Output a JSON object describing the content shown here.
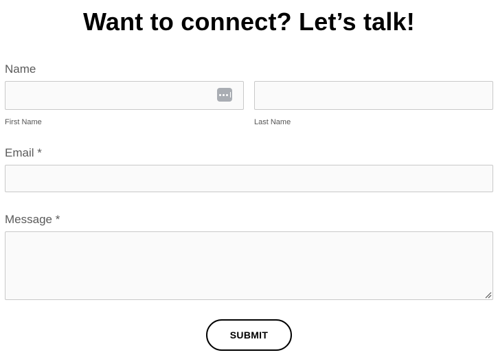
{
  "form": {
    "title": "Want to connect? Let’s talk!",
    "name": {
      "label": "Name",
      "first_name": {
        "value": "",
        "sublabel": "First Name"
      },
      "last_name": {
        "value": "",
        "sublabel": "Last Name"
      },
      "autofill_icon": "password-manager-icon"
    },
    "email": {
      "label": "Email *",
      "value": ""
    },
    "message": {
      "label": "Message *",
      "value": "",
      "resize_icon": "resize-grip-icon"
    },
    "submit_label": "SUBMIT"
  },
  "colors": {
    "field_background": "#fafafa",
    "field_border": "#c8c8c8",
    "label_text": "#5a5a5a",
    "title_text": "#000000",
    "button_border": "#000000"
  }
}
